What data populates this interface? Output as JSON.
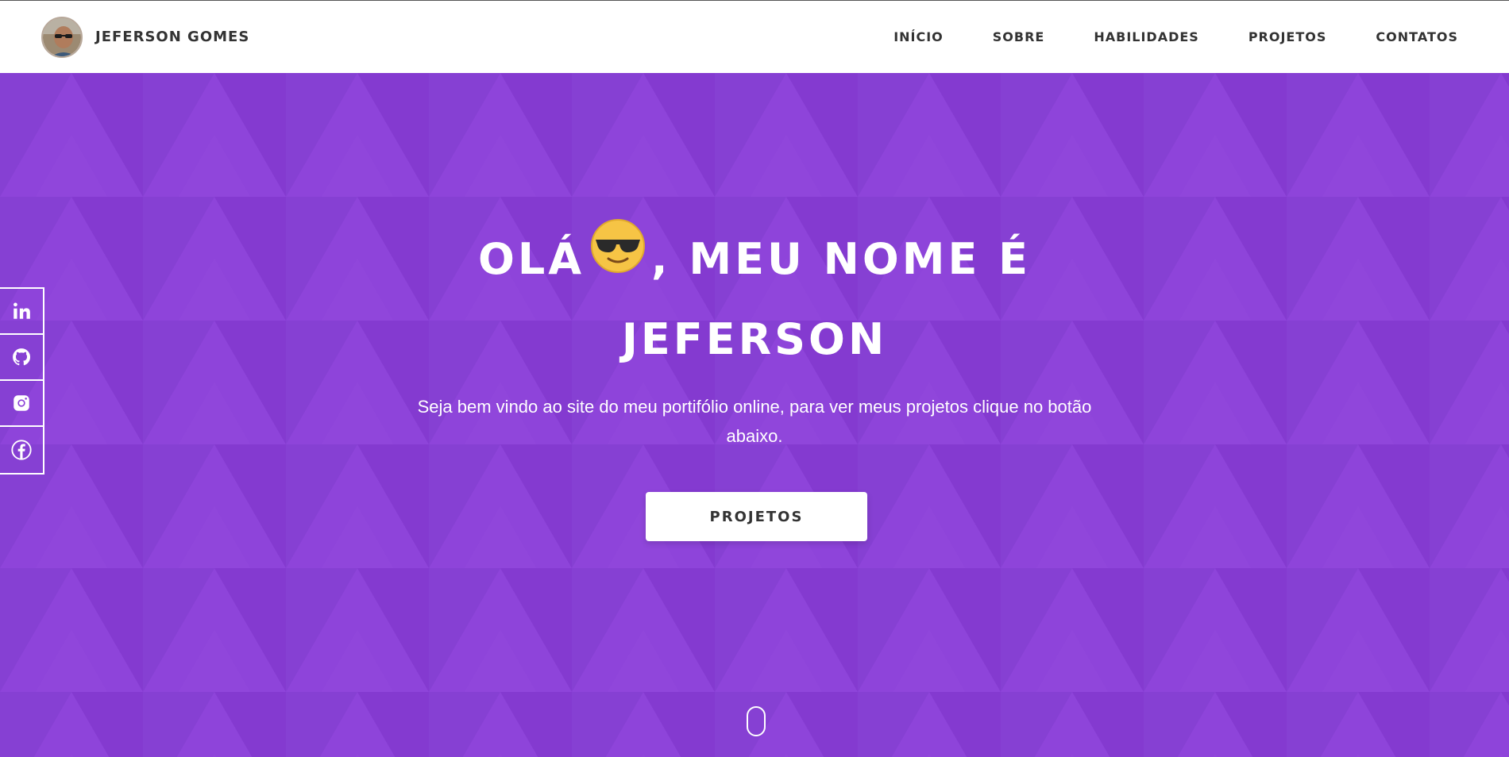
{
  "brand": {
    "name": "JEFERSON GOMES",
    "avatar_icon": "avatar-photo"
  },
  "nav": {
    "items": [
      {
        "label": "INÍCIO"
      },
      {
        "label": "SOBRE"
      },
      {
        "label": "HABILIDADES"
      },
      {
        "label": "PROJETOS"
      },
      {
        "label": "CONTATOS"
      }
    ]
  },
  "hero": {
    "title_part1": "OLÁ",
    "title_emoji": "sunglasses-emoji",
    "title_part2": ", MEU NOME É",
    "title_line2": "JEFERSON",
    "subtitle": "Seja bem vindo ao site do meu portifólio online, para ver meus projetos clique no botão abaixo.",
    "button_label": "PROJETOS"
  },
  "social": {
    "items": [
      {
        "icon": "linkedin-icon"
      },
      {
        "icon": "github-icon"
      },
      {
        "icon": "instagram-icon"
      },
      {
        "icon": "facebook-icon"
      }
    ]
  },
  "colors": {
    "hero_bg": "#8a3fd6",
    "navbar_bg": "#ffffff",
    "nav_text": "#333333",
    "button_bg": "#ffffff"
  }
}
